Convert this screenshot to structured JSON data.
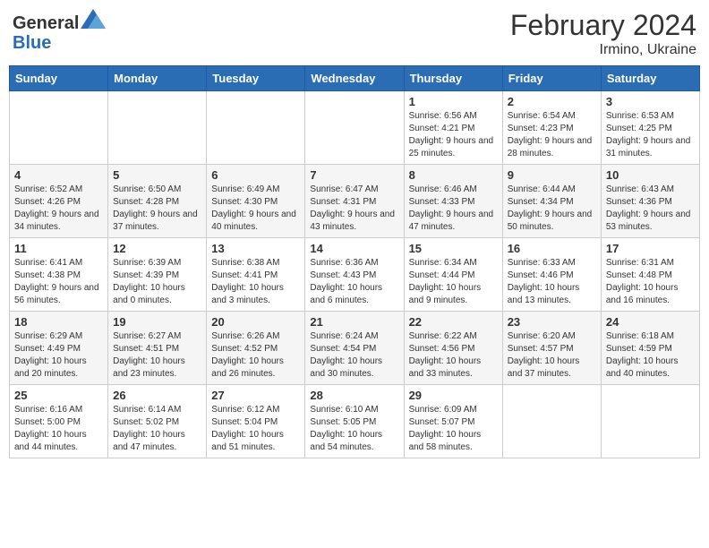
{
  "logo": {
    "general": "General",
    "blue": "Blue"
  },
  "header": {
    "title": "February 2024",
    "subtitle": "Irmino, Ukraine"
  },
  "days_of_week": [
    "Sunday",
    "Monday",
    "Tuesday",
    "Wednesday",
    "Thursday",
    "Friday",
    "Saturday"
  ],
  "weeks": [
    [
      {
        "day": "",
        "info": ""
      },
      {
        "day": "",
        "info": ""
      },
      {
        "day": "",
        "info": ""
      },
      {
        "day": "",
        "info": ""
      },
      {
        "day": "1",
        "info": "Sunrise: 6:56 AM\nSunset: 4:21 PM\nDaylight: 9 hours and 25 minutes."
      },
      {
        "day": "2",
        "info": "Sunrise: 6:54 AM\nSunset: 4:23 PM\nDaylight: 9 hours and 28 minutes."
      },
      {
        "day": "3",
        "info": "Sunrise: 6:53 AM\nSunset: 4:25 PM\nDaylight: 9 hours and 31 minutes."
      }
    ],
    [
      {
        "day": "4",
        "info": "Sunrise: 6:52 AM\nSunset: 4:26 PM\nDaylight: 9 hours and 34 minutes."
      },
      {
        "day": "5",
        "info": "Sunrise: 6:50 AM\nSunset: 4:28 PM\nDaylight: 9 hours and 37 minutes."
      },
      {
        "day": "6",
        "info": "Sunrise: 6:49 AM\nSunset: 4:30 PM\nDaylight: 9 hours and 40 minutes."
      },
      {
        "day": "7",
        "info": "Sunrise: 6:47 AM\nSunset: 4:31 PM\nDaylight: 9 hours and 43 minutes."
      },
      {
        "day": "8",
        "info": "Sunrise: 6:46 AM\nSunset: 4:33 PM\nDaylight: 9 hours and 47 minutes."
      },
      {
        "day": "9",
        "info": "Sunrise: 6:44 AM\nSunset: 4:34 PM\nDaylight: 9 hours and 50 minutes."
      },
      {
        "day": "10",
        "info": "Sunrise: 6:43 AM\nSunset: 4:36 PM\nDaylight: 9 hours and 53 minutes."
      }
    ],
    [
      {
        "day": "11",
        "info": "Sunrise: 6:41 AM\nSunset: 4:38 PM\nDaylight: 9 hours and 56 minutes."
      },
      {
        "day": "12",
        "info": "Sunrise: 6:39 AM\nSunset: 4:39 PM\nDaylight: 10 hours and 0 minutes."
      },
      {
        "day": "13",
        "info": "Sunrise: 6:38 AM\nSunset: 4:41 PM\nDaylight: 10 hours and 3 minutes."
      },
      {
        "day": "14",
        "info": "Sunrise: 6:36 AM\nSunset: 4:43 PM\nDaylight: 10 hours and 6 minutes."
      },
      {
        "day": "15",
        "info": "Sunrise: 6:34 AM\nSunset: 4:44 PM\nDaylight: 10 hours and 9 minutes."
      },
      {
        "day": "16",
        "info": "Sunrise: 6:33 AM\nSunset: 4:46 PM\nDaylight: 10 hours and 13 minutes."
      },
      {
        "day": "17",
        "info": "Sunrise: 6:31 AM\nSunset: 4:48 PM\nDaylight: 10 hours and 16 minutes."
      }
    ],
    [
      {
        "day": "18",
        "info": "Sunrise: 6:29 AM\nSunset: 4:49 PM\nDaylight: 10 hours and 20 minutes."
      },
      {
        "day": "19",
        "info": "Sunrise: 6:27 AM\nSunset: 4:51 PM\nDaylight: 10 hours and 23 minutes."
      },
      {
        "day": "20",
        "info": "Sunrise: 6:26 AM\nSunset: 4:52 PM\nDaylight: 10 hours and 26 minutes."
      },
      {
        "day": "21",
        "info": "Sunrise: 6:24 AM\nSunset: 4:54 PM\nDaylight: 10 hours and 30 minutes."
      },
      {
        "day": "22",
        "info": "Sunrise: 6:22 AM\nSunset: 4:56 PM\nDaylight: 10 hours and 33 minutes."
      },
      {
        "day": "23",
        "info": "Sunrise: 6:20 AM\nSunset: 4:57 PM\nDaylight: 10 hours and 37 minutes."
      },
      {
        "day": "24",
        "info": "Sunrise: 6:18 AM\nSunset: 4:59 PM\nDaylight: 10 hours and 40 minutes."
      }
    ],
    [
      {
        "day": "25",
        "info": "Sunrise: 6:16 AM\nSunset: 5:00 PM\nDaylight: 10 hours and 44 minutes."
      },
      {
        "day": "26",
        "info": "Sunrise: 6:14 AM\nSunset: 5:02 PM\nDaylight: 10 hours and 47 minutes."
      },
      {
        "day": "27",
        "info": "Sunrise: 6:12 AM\nSunset: 5:04 PM\nDaylight: 10 hours and 51 minutes."
      },
      {
        "day": "28",
        "info": "Sunrise: 6:10 AM\nSunset: 5:05 PM\nDaylight: 10 hours and 54 minutes."
      },
      {
        "day": "29",
        "info": "Sunrise: 6:09 AM\nSunset: 5:07 PM\nDaylight: 10 hours and 58 minutes."
      },
      {
        "day": "",
        "info": ""
      },
      {
        "day": "",
        "info": ""
      }
    ]
  ]
}
